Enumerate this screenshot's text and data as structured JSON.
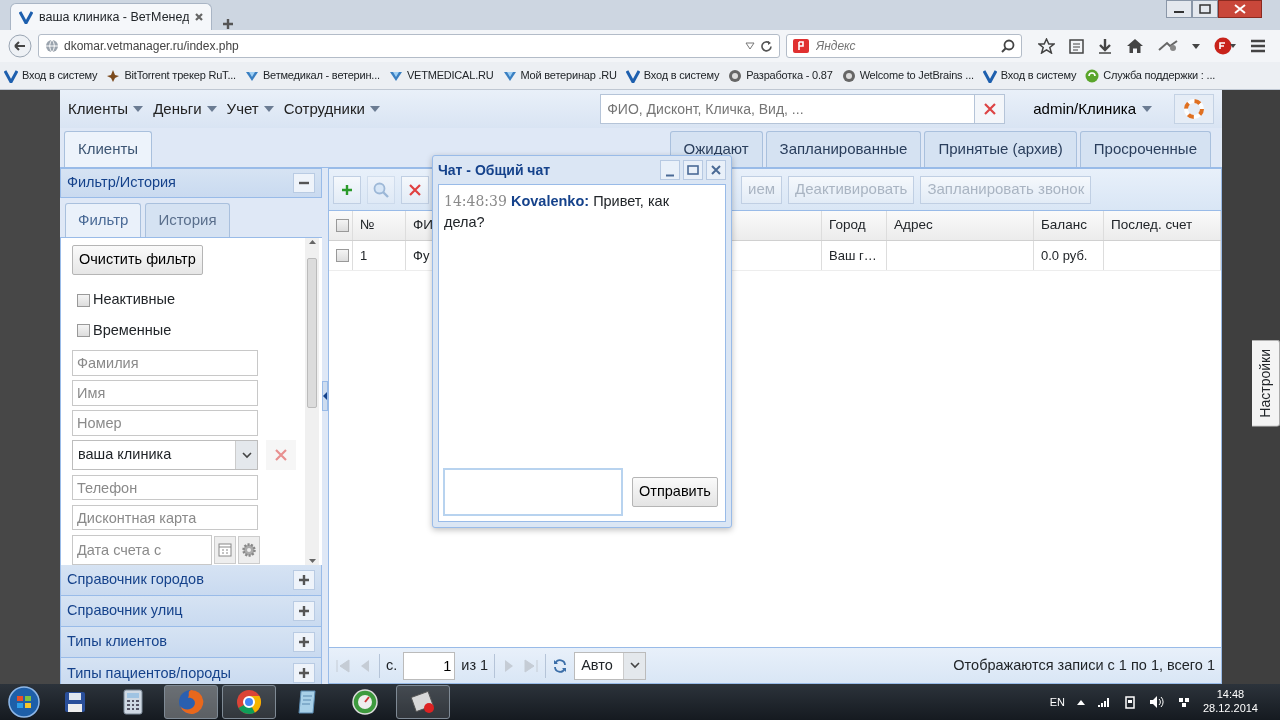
{
  "browser": {
    "tab": {
      "title": "ваша клиника - ВетМенед",
      "selected": true
    },
    "url": "dkomar.vetmanager.ru/index.php",
    "search": {
      "placeholder": "Яндекс"
    },
    "bookmarks": [
      {
        "kind": "vetmanager",
        "label": "Вход в систему"
      },
      {
        "kind": "torrent",
        "label": "BitTorrent трекер RuT..."
      },
      {
        "kind": "vetmedical",
        "label": "Ветмедикал - ветерин..."
      },
      {
        "kind": "vetmedical",
        "label": "VETMEDICAL.RU"
      },
      {
        "kind": "vetmedical",
        "label": "Мой ветеринар .RU"
      },
      {
        "kind": "vetmanager",
        "label": "Вход в систему"
      },
      {
        "kind": "gear",
        "label": "Разработка - 0.87"
      },
      {
        "kind": "gear",
        "label": "Welcome to JetBrains ..."
      },
      {
        "kind": "vetmanager",
        "label": "Вход в систему"
      },
      {
        "kind": "support",
        "label": "Служба поддержки : ..."
      }
    ]
  },
  "app": {
    "menu": [
      {
        "label": "Клиенты"
      },
      {
        "label": "Деньги"
      },
      {
        "label": "Учет"
      },
      {
        "label": "Сотрудники"
      }
    ],
    "search": {
      "placeholder": "ФИО, Дисконт, Кличка, Вид, ..."
    },
    "user": "admin/Клиника",
    "tabs": [
      {
        "label": "Клиенты",
        "selected": true
      }
    ],
    "right_tabs": [
      {
        "label": "Ожидают",
        "selected": false
      },
      {
        "label": "Запланированные",
        "selected": false
      },
      {
        "label": "Принятые (архив)",
        "selected": false
      },
      {
        "label": "Просроченные",
        "selected": false
      }
    ],
    "filter_panel": {
      "title": "Фильтр/История",
      "expanded": true,
      "tabs": [
        {
          "label": "Фильтр",
          "selected": true
        },
        {
          "label": "История",
          "selected": false
        }
      ],
      "clear_button": "Очистить фильтр",
      "checkboxes": [
        {
          "label": "Неактивные",
          "checked": false
        },
        {
          "label": "Временные",
          "checked": false
        }
      ],
      "fields": [
        {
          "kind": "text",
          "placeholder": "Фамилия"
        },
        {
          "kind": "text",
          "placeholder": "Имя"
        },
        {
          "kind": "text",
          "placeholder": "Номер"
        },
        {
          "kind": "select",
          "value": "ваша клиника"
        },
        {
          "kind": "text",
          "placeholder": "Телефон"
        },
        {
          "kind": "text",
          "placeholder": "Дисконтная карта"
        },
        {
          "kind": "date",
          "placeholder": "Дата счета с"
        }
      ]
    },
    "sections": [
      {
        "title": "Справочник городов",
        "expanded": false
      },
      {
        "title": "Справочник улиц",
        "expanded": false
      },
      {
        "title": "Типы клиентов",
        "expanded": false
      },
      {
        "title": "Типы пациентов/породы",
        "expanded": false
      }
    ],
    "toolbar": {
      "icon_buttons": [
        {
          "disabled": false
        },
        {
          "disabled": true
        },
        {
          "disabled": false
        }
      ],
      "buttons": [
        {
          "label": "ием",
          "disabled": true
        },
        {
          "label": "Деактивировать",
          "disabled": true
        },
        {
          "label": "Запланировать звонок",
          "disabled": true
        }
      ]
    },
    "table": {
      "header_checked": false,
      "columns": [
        "№",
        "ФИ",
        "Город",
        "Адрес",
        "Баланс",
        "Послед. счет"
      ],
      "rows": [
        {
          "checked": false,
          "cells": [
            "1",
            "Фу",
            "Ваш г…",
            null,
            "0.0 руб.",
            null
          ]
        }
      ]
    },
    "paging": {
      "page_label": "с.",
      "page": "1",
      "of": "из 1",
      "page_size": "Авто",
      "summary": "Отображаются записи с 1 по 1, всего 1"
    },
    "settings_tab": "Настройки",
    "chat": {
      "title": "Чат - Общий чат",
      "messages": [
        {
          "time": "14:48:39",
          "author": "Kovalenko:",
          "text": "Привет, как дела?"
        }
      ],
      "send_button": "Отправить"
    }
  },
  "taskbar": {
    "apps": [
      {
        "kind": "save",
        "running": false,
        "selected": false
      },
      {
        "kind": "calculator",
        "running": false,
        "selected": false
      },
      {
        "kind": "firefox",
        "running": true,
        "selected": true
      },
      {
        "kind": "chrome",
        "running": true,
        "selected": false
      },
      {
        "kind": "notepad",
        "running": false,
        "selected": false
      },
      {
        "kind": "gauge",
        "running": false,
        "selected": false
      },
      {
        "kind": "app",
        "running": true,
        "selected": false
      }
    ],
    "language": "EN",
    "time": "14:48",
    "date": "28.12.2014"
  }
}
